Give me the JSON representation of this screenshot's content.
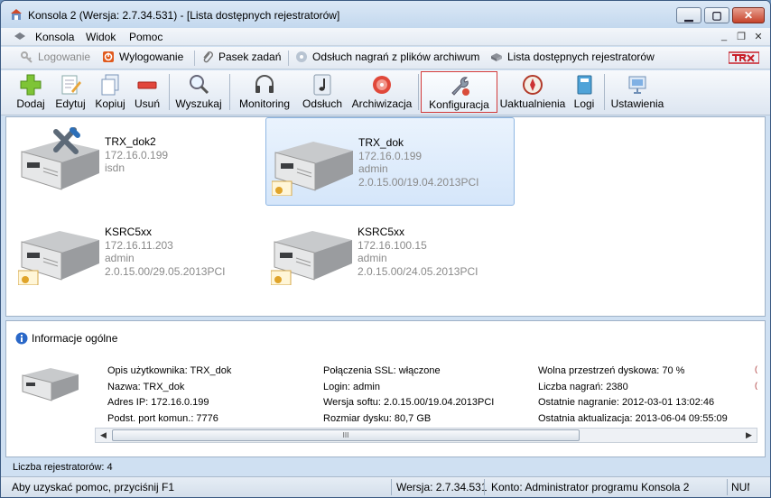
{
  "window": {
    "title": "Konsola 2 (Wersja:  2.7.34.531) - [Lista dostępnych rejestratorów]"
  },
  "menu": {
    "items": [
      "Konsola",
      "Widok",
      "Pomoc"
    ]
  },
  "tabs": [
    {
      "label": "Logowanie",
      "icon": "key-icon",
      "enabled": false
    },
    {
      "label": "Wylogowanie",
      "icon": "logout-icon",
      "enabled": true
    },
    {
      "label": "Pasek zadań",
      "icon": "paperclip-icon",
      "enabled": true
    },
    {
      "label": "Odsłuch nagrań z plików archiwum",
      "icon": "disc-icon",
      "enabled": true
    },
    {
      "label": "Lista dostępnych rejestratorów",
      "icon": "recorder-icon",
      "enabled": true
    }
  ],
  "brand": {
    "logo_text": "TRX",
    "color": "#c8202a"
  },
  "toolbar": {
    "buttons": [
      {
        "label": "Dodaj",
        "icon": "plus-icon"
      },
      {
        "label": "Edytuj",
        "icon": "edit-icon"
      },
      {
        "label": "Kopiuj",
        "icon": "copy-icon"
      },
      {
        "label": "Usuń",
        "icon": "minus-icon"
      },
      {
        "label": "Wyszukaj",
        "icon": "magnifier-icon"
      },
      {
        "label": "Monitoring",
        "icon": "headphones-icon"
      },
      {
        "label": "Odsłuch",
        "icon": "music-note-icon"
      },
      {
        "label": "Archiwizacja",
        "icon": "archive-disc-icon"
      },
      {
        "label": "Konfiguracja",
        "icon": "wrench-icon",
        "active": true
      },
      {
        "label": "Uaktualnienia",
        "icon": "compass-icon"
      },
      {
        "label": "Logi",
        "icon": "notebook-icon"
      },
      {
        "label": "Ustawienia",
        "icon": "settings-icon"
      }
    ]
  },
  "devices": [
    {
      "name": "TRX_dok2",
      "ip": "172.16.0.199",
      "line3": "isdn",
      "line4": "",
      "overlay": "tools-icon",
      "selected": false
    },
    {
      "name": "TRX_dok",
      "ip": "172.16.0.199",
      "line3": "admin",
      "line4": "2.0.15.00/19.04.2013PCI",
      "overlay": "certificate-icon",
      "selected": true
    },
    {
      "name": "KSRC5xx",
      "ip": "172.16.11.203",
      "line3": "admin",
      "line4": "2.0.15.00/29.05.2013PCI",
      "overlay": "certificate-icon",
      "selected": false
    },
    {
      "name": "KSRC5xx",
      "ip": "172.16.100.15",
      "line3": "admin",
      "line4": "2.0.15.00/24.05.2013PCI",
      "overlay": "certificate-icon",
      "selected": false
    }
  ],
  "info": {
    "heading": "Informacje ogólne",
    "col1": [
      "Opis użytkownika: TRX_dok",
      "Nazwa: TRX_dok",
      "Adres IP: 172.16.0.199",
      "Podst. port komun.: 7776"
    ],
    "col2": [
      "Połączenia SSL: włączone",
      "Login: admin",
      "Wersja softu: 2.0.15.00/19.04.2013PCI",
      "Rozmiar dysku: 80,7 GB"
    ],
    "col3": [
      "Wolna przestrzeń dyskowa: 70 %",
      "Liczba nagrań: 2380",
      "Ostatnie nagranie: 2012-03-01 13:02:46",
      "Ostatnia aktualizacja: 2013-06-04 09:55:09"
    ],
    "scroll_grip": "III"
  },
  "count_text": "Liczba rejestratorów: 4",
  "status": {
    "help": "Aby uzyskać pomoc, przyciśnij F1",
    "version": "Wersja: 2.7.34.531",
    "account": "Konto: Administrator programu Konsola 2",
    "num": "NUM"
  }
}
